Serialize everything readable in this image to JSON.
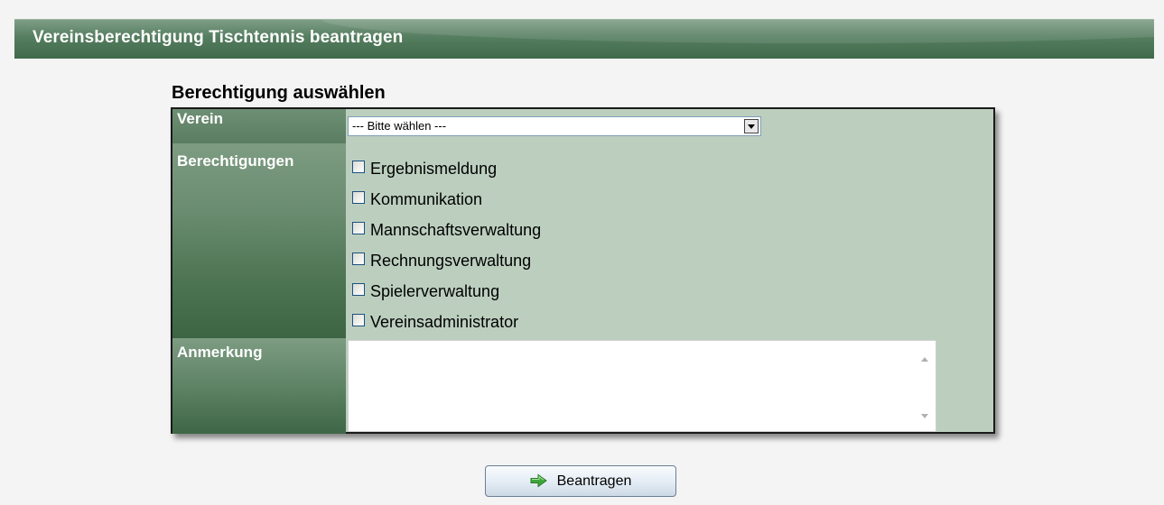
{
  "header": {
    "title": "Vereinsberechtigung Tischtennis beantragen"
  },
  "form": {
    "heading": "Berechtigung auswählen",
    "verein": {
      "label": "Verein",
      "selected": "--- Bitte wählen ---"
    },
    "berechtigungen": {
      "label": "Berechtigungen",
      "options": [
        {
          "label": "Ergebnismeldung",
          "checked": false
        },
        {
          "label": "Kommunikation",
          "checked": false
        },
        {
          "label": "Mannschaftsverwaltung",
          "checked": false
        },
        {
          "label": "Rechnungsverwaltung",
          "checked": false
        },
        {
          "label": "Spielerverwaltung",
          "checked": false
        },
        {
          "label": "Vereinsadministrator",
          "checked": false
        }
      ]
    },
    "anmerkung": {
      "label": "Anmerkung",
      "value": ""
    },
    "submit_label": "Beantragen"
  },
  "colors": {
    "panel_bg": "#bccfbf",
    "header_green": "#557d5f",
    "label_green": "#5a7d61",
    "button_arrow": "#3fa63a"
  },
  "icons": {
    "submit": "arrow-right-icon",
    "select": "chevron-down-icon",
    "scroll_up": "scroll-up-icon",
    "scroll_down": "scroll-down-icon"
  }
}
